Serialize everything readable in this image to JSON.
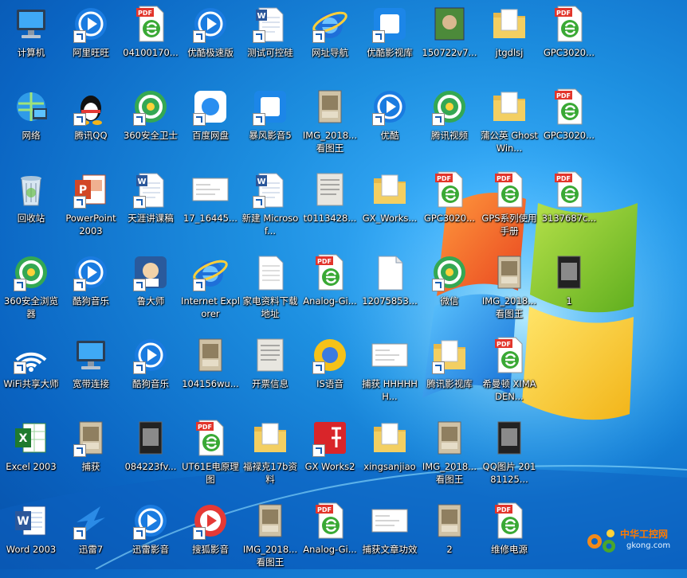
{
  "desktop": {
    "icons": [
      {
        "label": "计算机",
        "art": "computer-icon",
        "kind": "computer",
        "col": 0,
        "row": 0
      },
      {
        "label": "网络",
        "art": "network-icon",
        "kind": "network",
        "col": 0,
        "row": 1
      },
      {
        "label": "回收站",
        "art": "recycle-bin-icon",
        "kind": "bin",
        "col": 0,
        "row": 2
      },
      {
        "label": "360安全浏览器",
        "art": "browser-360-icon",
        "kind": "round-green",
        "col": 0,
        "row": 3,
        "shortcut": true
      },
      {
        "label": "WiFi共享大师",
        "art": "wifi-icon",
        "kind": "wifi",
        "col": 0,
        "row": 4,
        "shortcut": true
      },
      {
        "label": "Excel 2003",
        "art": "excel-icon",
        "kind": "excel",
        "col": 0,
        "row": 5
      },
      {
        "label": "Word 2003",
        "art": "word-icon",
        "kind": "word",
        "col": 0,
        "row": 6
      },
      {
        "label": "阿里旺旺",
        "art": "aliwangwang-icon",
        "kind": "round-blue",
        "col": 1,
        "row": 0,
        "shortcut": true
      },
      {
        "label": "腾讯QQ",
        "art": "qq-icon",
        "kind": "qq",
        "col": 1,
        "row": 1,
        "shortcut": true
      },
      {
        "label": "PowerPoint 2003",
        "art": "powerpoint-icon",
        "kind": "ppt",
        "col": 1,
        "row": 2,
        "shortcut": true
      },
      {
        "label": "酷狗音乐",
        "art": "kugou-icon",
        "kind": "round-blue",
        "col": 1,
        "row": 3,
        "shortcut": true
      },
      {
        "label": "宽带连接",
        "art": "broadband-icon",
        "kind": "computer",
        "col": 1,
        "row": 4
      },
      {
        "label": "捕获",
        "art": "image-icon",
        "kind": "photo",
        "col": 1,
        "row": 5,
        "shortcut": true
      },
      {
        "label": "迅雷7",
        "art": "xunlei-icon",
        "kind": "bird",
        "col": 1,
        "row": 6,
        "shortcut": true
      },
      {
        "label": "04100170...",
        "art": "pdf-icon",
        "kind": "pdf",
        "col": 2,
        "row": 0
      },
      {
        "label": "360安全卫士",
        "art": "security-360-icon",
        "kind": "round-green",
        "col": 2,
        "row": 1,
        "shortcut": true
      },
      {
        "label": "天涯讲课稿",
        "art": "word-doc-icon",
        "kind": "worddoc",
        "col": 2,
        "row": 2,
        "shortcut": true
      },
      {
        "label": "鲁大师",
        "art": "ludashi-icon",
        "kind": "dark",
        "col": 2,
        "row": 3,
        "shortcut": true
      },
      {
        "label": "酷狗音乐",
        "art": "kugou-icon",
        "kind": "round-blue",
        "col": 2,
        "row": 4,
        "shortcut": true
      },
      {
        "label": "084223fv...",
        "art": "image-icon",
        "kind": "darkphoto",
        "col": 2,
        "row": 5
      },
      {
        "label": "迅雷影音",
        "art": "xunlei-player-icon",
        "kind": "round-blue",
        "col": 2,
        "row": 6,
        "shortcut": true
      },
      {
        "label": "优酷极速版",
        "art": "youku-icon",
        "kind": "round-blue",
        "col": 3,
        "row": 0,
        "shortcut": true
      },
      {
        "label": "百度网盘",
        "art": "baidu-pan-icon",
        "kind": "white-blue",
        "col": 3,
        "row": 1,
        "shortcut": true
      },
      {
        "label": "17_16445...",
        "art": "image-icon",
        "kind": "sketch",
        "col": 3,
        "row": 2
      },
      {
        "label": "Internet Explorer",
        "art": "ie-icon",
        "kind": "ie",
        "col": 3,
        "row": 3,
        "shortcut": true
      },
      {
        "label": "104156wu...",
        "art": "image-icon",
        "kind": "photo",
        "col": 3,
        "row": 4
      },
      {
        "label": "UT61E电原理图",
        "art": "pdf-icon",
        "kind": "pdf",
        "col": 3,
        "row": 5
      },
      {
        "label": "搜狐影音",
        "art": "sohu-icon",
        "kind": "round-red",
        "col": 3,
        "row": 6,
        "shortcut": true
      },
      {
        "label": "测试可控硅",
        "art": "word-doc-icon",
        "kind": "worddoc",
        "col": 4,
        "row": 0,
        "shortcut": true
      },
      {
        "label": "暴风影音5",
        "art": "baofeng-icon",
        "kind": "blue-square",
        "col": 4,
        "row": 1,
        "shortcut": true
      },
      {
        "label": "新建 Microsof...",
        "art": "word-doc-icon",
        "kind": "worddoc",
        "col": 4,
        "row": 2,
        "shortcut": true
      },
      {
        "label": "家电资料下载地址",
        "art": "text-file-icon",
        "kind": "textfile",
        "col": 4,
        "row": 3
      },
      {
        "label": "开票信息",
        "art": "image-icon",
        "kind": "paper",
        "col": 4,
        "row": 4
      },
      {
        "label": "福禄克17b资料",
        "art": "folder-icon",
        "kind": "folder",
        "col": 4,
        "row": 5
      },
      {
        "label": "IMG_2018... 看图王",
        "art": "image-icon",
        "kind": "photo",
        "col": 4,
        "row": 6
      },
      {
        "label": "网址导航",
        "art": "ie-icon",
        "kind": "ie",
        "col": 5,
        "row": 0,
        "shortcut": true
      },
      {
        "label": "IMG_2018... 看图王",
        "art": "image-icon",
        "kind": "photo",
        "col": 5,
        "row": 1
      },
      {
        "label": "t0113428...",
        "art": "image-icon",
        "kind": "paper",
        "col": 5,
        "row": 2
      },
      {
        "label": "Analog-Gi...",
        "art": "pdf-icon",
        "kind": "pdf",
        "col": 5,
        "row": 3
      },
      {
        "label": "IS语音",
        "art": "is-voice-icon",
        "kind": "round-yellow",
        "col": 5,
        "row": 4,
        "shortcut": true
      },
      {
        "label": "GX Works2",
        "art": "gx-works-icon",
        "kind": "red-square",
        "col": 5,
        "row": 5,
        "shortcut": true
      },
      {
        "label": "Analog-Gi...",
        "art": "pdf-icon",
        "kind": "pdf",
        "col": 5,
        "row": 6
      },
      {
        "label": "优酷影视库",
        "art": "youku-library-icon",
        "kind": "blue-square",
        "col": 6,
        "row": 0,
        "shortcut": true
      },
      {
        "label": "优酷",
        "art": "youku-icon",
        "kind": "round-blue",
        "col": 6,
        "row": 1,
        "shortcut": true
      },
      {
        "label": "GX_Works...",
        "art": "folder-icon",
        "kind": "folder",
        "col": 6,
        "row": 2
      },
      {
        "label": "12075853...",
        "art": "file-icon",
        "kind": "blank",
        "col": 6,
        "row": 3
      },
      {
        "label": "捕获 HHHHHH...",
        "art": "image-icon",
        "kind": "sketch",
        "col": 6,
        "row": 4
      },
      {
        "label": "xingsanjiao",
        "art": "folder-icon",
        "kind": "folder",
        "col": 6,
        "row": 5
      },
      {
        "label": "捕获文章功效",
        "art": "image-icon",
        "kind": "sketch",
        "col": 6,
        "row": 6
      },
      {
        "label": "150722v7...",
        "art": "image-icon",
        "kind": "greenphoto",
        "col": 7,
        "row": 0
      },
      {
        "label": "腾讯视频",
        "art": "tencent-video-icon",
        "kind": "round-green",
        "col": 7,
        "row": 1,
        "shortcut": true
      },
      {
        "label": "GPC3020...",
        "art": "pdf-icon",
        "kind": "pdf",
        "col": 7,
        "row": 2
      },
      {
        "label": "微信",
        "art": "wechat-icon",
        "kind": "round-green",
        "col": 7,
        "row": 3,
        "shortcut": true
      },
      {
        "label": "腾讯影视库",
        "art": "folder-icon",
        "kind": "folder",
        "col": 7,
        "row": 4,
        "shortcut": true
      },
      {
        "label": "IMG_2018... 看图王",
        "art": "image-icon",
        "kind": "photo",
        "col": 7,
        "row": 5
      },
      {
        "label": "2",
        "art": "image-icon",
        "kind": "photo",
        "col": 7,
        "row": 6
      },
      {
        "label": "jtgdlsj",
        "art": "folder-icon",
        "kind": "folder",
        "col": 8,
        "row": 0
      },
      {
        "label": "蒲公英 Ghost Win...",
        "art": "folder-icon",
        "kind": "folder",
        "col": 8,
        "row": 1
      },
      {
        "label": "GPS系列使用手册",
        "art": "pdf-icon",
        "kind": "pdf",
        "col": 8,
        "row": 2
      },
      {
        "label": "IMG_2018... 看图王",
        "art": "image-icon",
        "kind": "photo",
        "col": 8,
        "row": 3
      },
      {
        "label": "希曼顿 XIMADEN...",
        "art": "pdf-icon",
        "kind": "pdf",
        "col": 8,
        "row": 4
      },
      {
        "label": "QQ图片 20181125...",
        "art": "image-icon",
        "kind": "darkphoto",
        "col": 8,
        "row": 5
      },
      {
        "label": "维修电源",
        "art": "pdf-icon",
        "kind": "pdf",
        "col": 8,
        "row": 6
      },
      {
        "label": "GPC3020...",
        "art": "pdf-icon",
        "kind": "pdf",
        "col": 9,
        "row": 0
      },
      {
        "label": "GPC3020...",
        "art": "pdf-icon",
        "kind": "pdf",
        "col": 9,
        "row": 1
      },
      {
        "label": "3137687c...",
        "art": "pdf-icon",
        "kind": "pdf",
        "col": 9,
        "row": 2
      },
      {
        "label": "1",
        "art": "image-icon",
        "kind": "darkphoto",
        "col": 9,
        "row": 3
      }
    ]
  },
  "watermark": {
    "text": "中华工控网",
    "url": "gkong.com",
    "art": "gear-logo-icon"
  },
  "colors": {
    "pdf_red": "#e2352b",
    "ie_blue": "#1e6fd9",
    "folder_yellow": "#f3cf62",
    "green": "#3aa935"
  }
}
